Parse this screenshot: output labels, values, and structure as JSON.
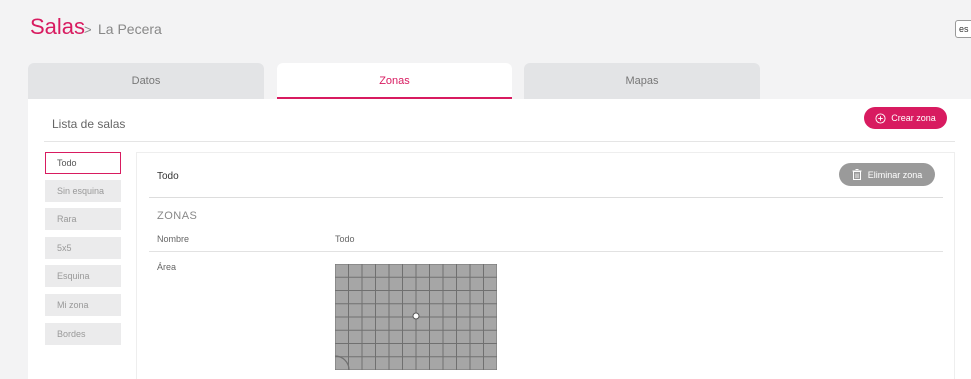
{
  "breadcrumb": {
    "title": "Salas",
    "separator": ">",
    "current": "La Pecera"
  },
  "language": "es",
  "tabs": [
    {
      "label": "Datos",
      "active": false
    },
    {
      "label": "Zonas",
      "active": true
    },
    {
      "label": "Mapas",
      "active": false
    }
  ],
  "list": {
    "title": "Lista de salas",
    "create_button": "Crear zona",
    "items": [
      "Todo",
      "Sin esquina",
      "Rara",
      "5x5",
      "Esquina",
      "Mi zona",
      "Bordes"
    ],
    "selected": "Todo"
  },
  "detail": {
    "title": "Todo",
    "delete_button": "Eliminar zona",
    "section": "ZONAS",
    "col_name": "Nombre",
    "col_value": "Todo",
    "row_label": "Área"
  },
  "colors": {
    "accent": "#d81b60",
    "map_cell": "#a6a6a6",
    "map_line": "#707070"
  },
  "icons": {
    "create": "plus-circle-icon",
    "delete": "trash-icon"
  }
}
